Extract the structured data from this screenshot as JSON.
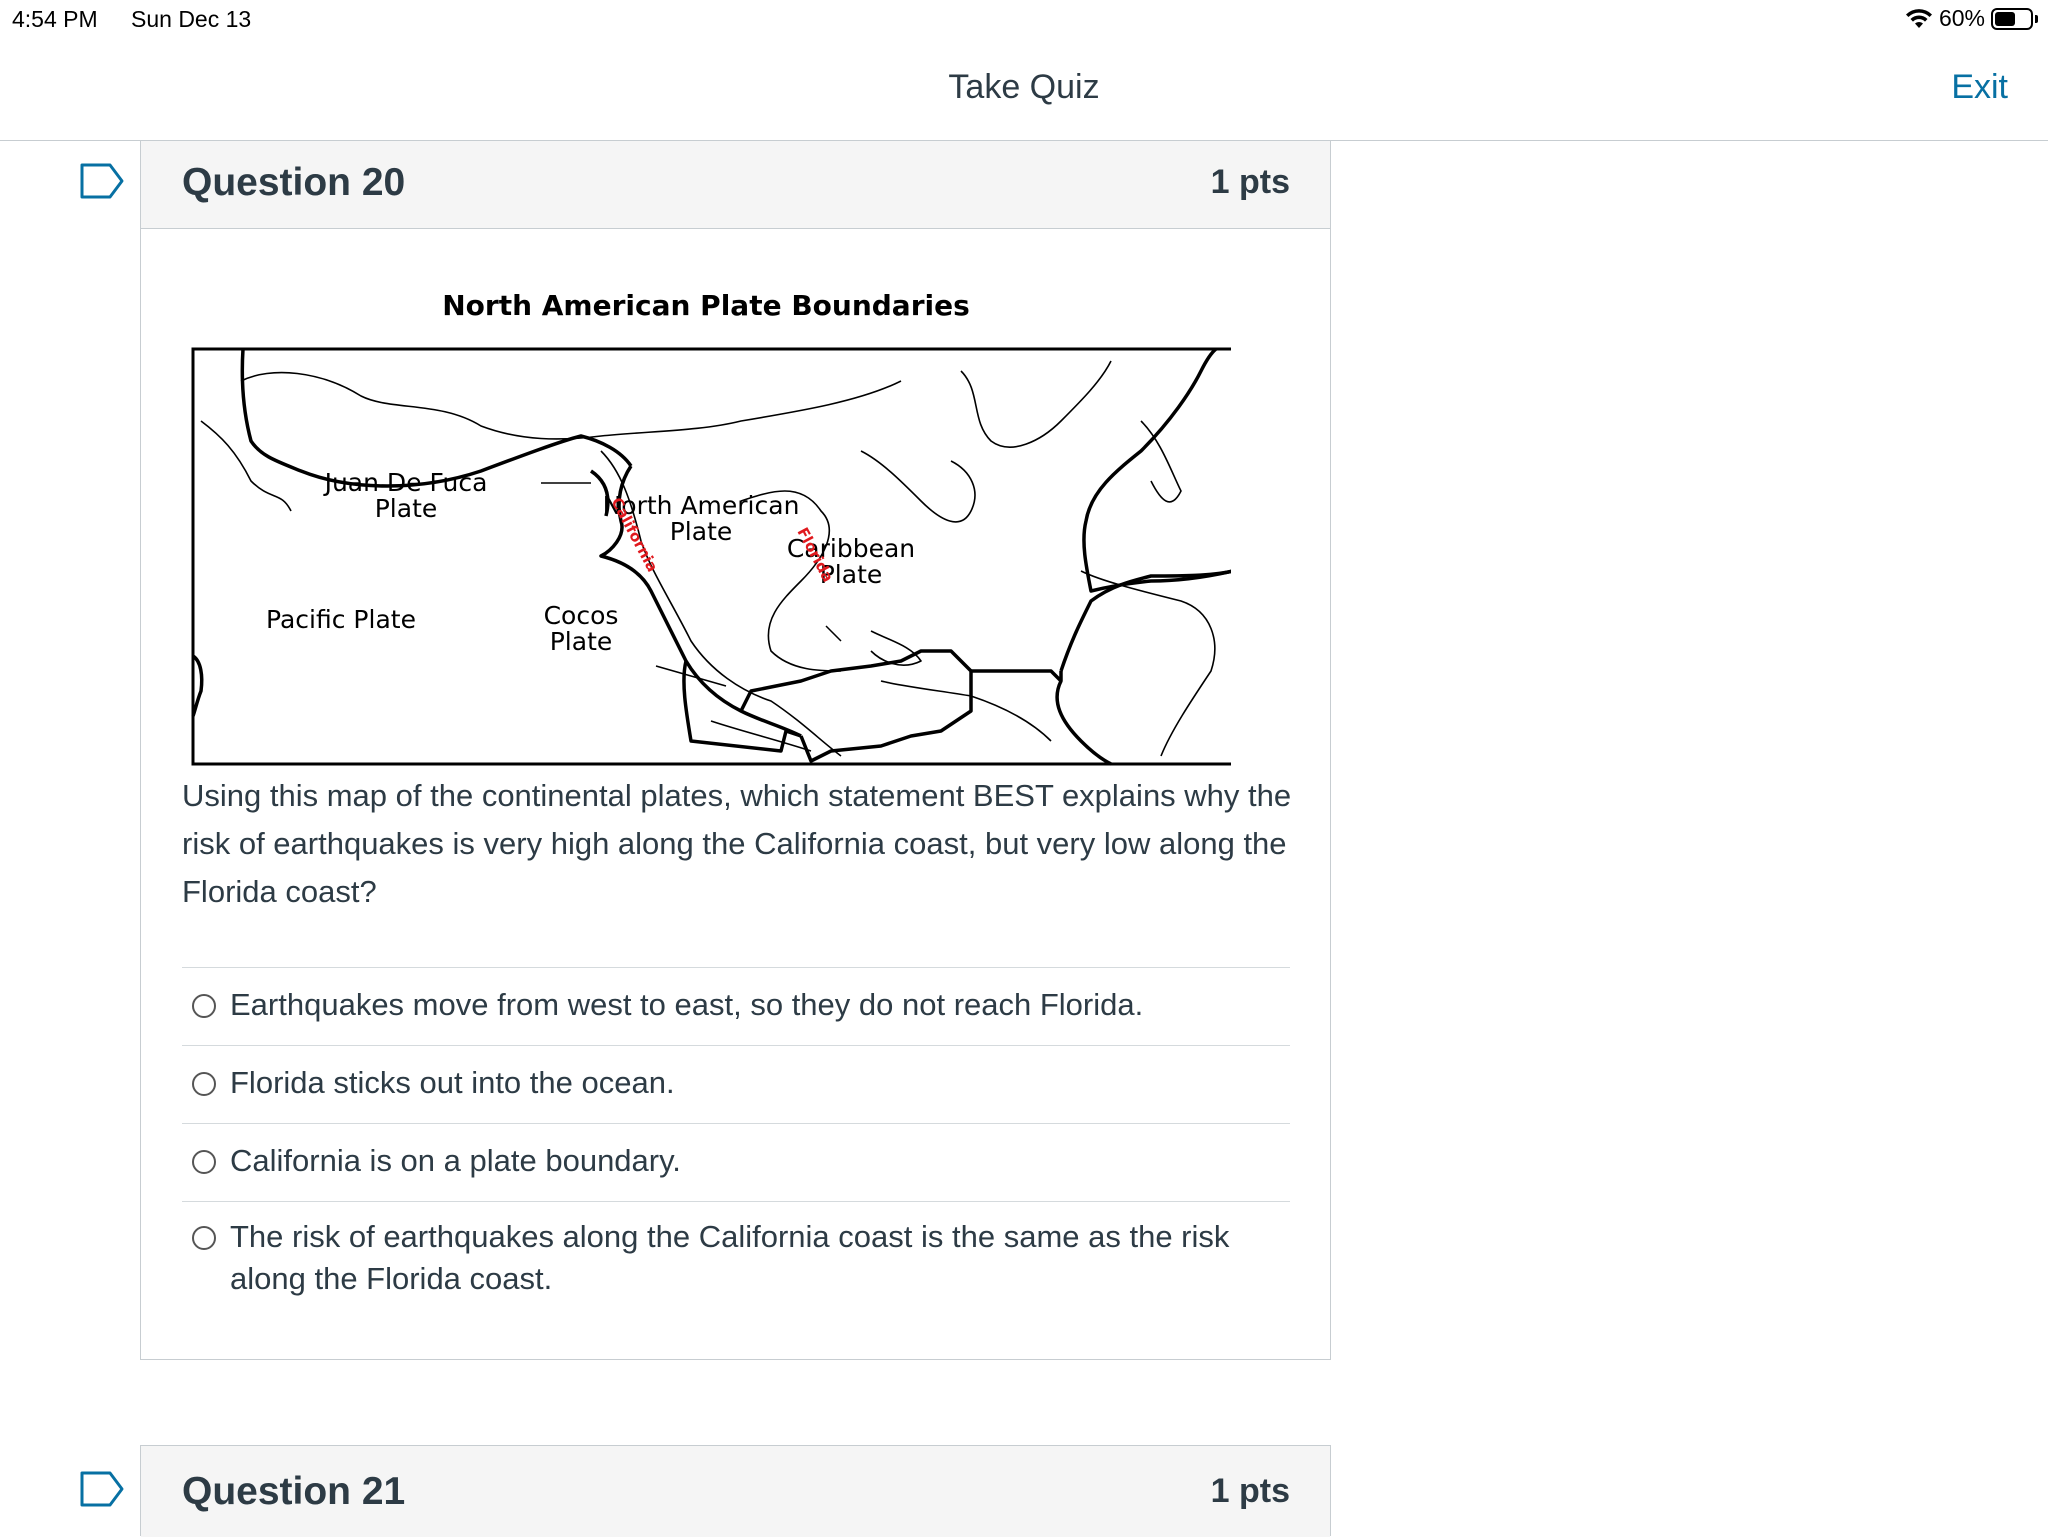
{
  "status_bar": {
    "time": "4:54 PM",
    "date": "Sun Dec 13",
    "battery": "60%",
    "battery_level": 0.6
  },
  "nav": {
    "title": "Take Quiz",
    "exit_label": "Exit"
  },
  "question20": {
    "name": "Question 20",
    "points": "1 pts",
    "map": {
      "title": "North American Plate Boundaries",
      "labels": {
        "juan_de_fuca_1": "Juan De Fuca",
        "juan_de_fuca_2": "Plate",
        "north_american_1": "North American",
        "north_american_2": "Plate",
        "caribbean_1": "Caribbean",
        "caribbean_2": "Plate",
        "pacific": "Pacific Plate",
        "cocos_1": "Cocos",
        "cocos_2": "Plate",
        "california": "California",
        "florida": "Florida"
      }
    },
    "text": "Using this map of the continental plates, which statement BEST explains why the risk of earthquakes is very high along the California coast, but very low along the Florida coast?",
    "answers": [
      "Earthquakes move from west to east, so they do not reach Florida.",
      "Florida sticks out into the ocean.",
      "California is on a plate boundary.",
      "The risk of earthquakes along the California coast is the same as the risk along the Florida coast."
    ]
  },
  "question21": {
    "name": "Question 21",
    "points": "1 pts"
  }
}
